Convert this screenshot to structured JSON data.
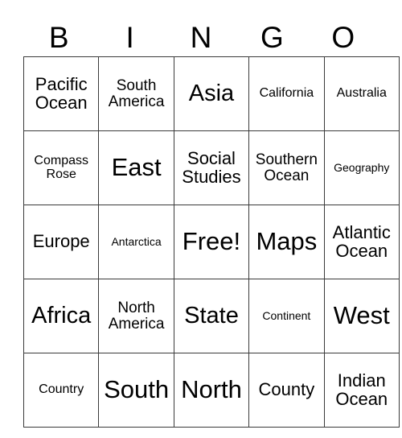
{
  "card": {
    "title": "BINGO",
    "header_letters": [
      "B",
      "I",
      "N",
      "G",
      "O"
    ],
    "free_space": "Free!",
    "grid": [
      [
        {
          "text": "Pacific\nOcean",
          "size": "md"
        },
        {
          "text": "South\nAmerica",
          "size": "sm"
        },
        {
          "text": "Asia",
          "size": "lg"
        },
        {
          "text": "California",
          "size": "xs"
        },
        {
          "text": "Australia",
          "size": "xs"
        }
      ],
      [
        {
          "text": "Compass\nRose",
          "size": "xs"
        },
        {
          "text": "East",
          "size": "xl"
        },
        {
          "text": "Social\nStudies",
          "size": "md"
        },
        {
          "text": "Southern\nOcean",
          "size": "sm"
        },
        {
          "text": "Geography",
          "size": "xxs"
        }
      ],
      [
        {
          "text": "Europe",
          "size": "md"
        },
        {
          "text": "Antarctica",
          "size": "xxs"
        },
        {
          "text": "Free!",
          "size": "xl"
        },
        {
          "text": "Maps",
          "size": "xl"
        },
        {
          "text": "Atlantic\nOcean",
          "size": "md"
        }
      ],
      [
        {
          "text": "Africa",
          "size": "lg"
        },
        {
          "text": "North\nAmerica",
          "size": "sm"
        },
        {
          "text": "State",
          "size": "lg"
        },
        {
          "text": "Continent",
          "size": "xxs"
        },
        {
          "text": "West",
          "size": "xl"
        }
      ],
      [
        {
          "text": "Country",
          "size": "xs"
        },
        {
          "text": "South",
          "size": "xl"
        },
        {
          "text": "North",
          "size": "xl"
        },
        {
          "text": "County",
          "size": "md"
        },
        {
          "text": "Indian\nOcean",
          "size": "md"
        }
      ]
    ]
  },
  "colors": {
    "background": "#ffffff",
    "text": "#000000",
    "border": "#3a3a3a"
  }
}
